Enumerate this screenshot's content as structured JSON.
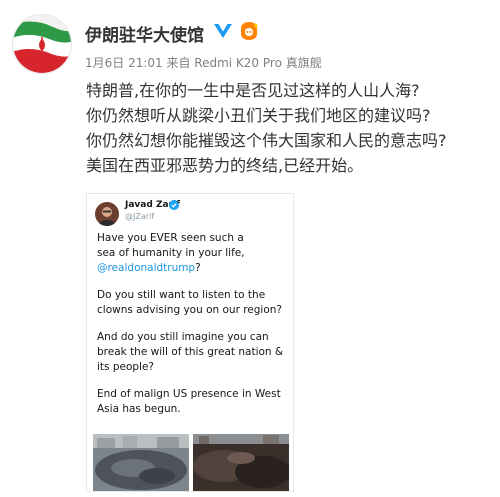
{
  "post": {
    "author": "伊朗驻华大使馆",
    "meta": "1月6日 21:01 来自 Redmi K20 Pro 真旗舰",
    "lines": [
      "特朗普,在你的一生中是否见过这样的人山人海?",
      "你仍然想听从跳梁小丑们关于我们地区的建议吗?",
      "你仍然幻想你能摧毁这个伟大国家和人民的意志吗?",
      "美国在西亚邪恶势力的终结,已经开始。"
    ]
  },
  "icons": {
    "avatar": "iran-flag-icon",
    "verified": "verified-badge-icon",
    "vip": "vip-badge-icon"
  },
  "colors": {
    "verified_blue": "#1d9bf0",
    "vip_orange": "#ff8200",
    "mention_blue": "#1b95e0"
  },
  "tweet": {
    "name": "Javad Zarif",
    "handle": "@JZarif",
    "p1_a": "Have you EVER seen such a",
    "p1_b": "sea of humanity in your life,",
    "mention": "@realdonaldtrump",
    "p1_end": "?",
    "p2_a": "Do you still want to listen to the",
    "p2_b": "clowns advising you on our region?",
    "p3_a": "And do you still imagine you can",
    "p3_b": "break the will of this great nation &",
    "p3_c": "its people?",
    "p4_a": "End of malign US presence in West",
    "p4_b": "Asia has begun."
  }
}
